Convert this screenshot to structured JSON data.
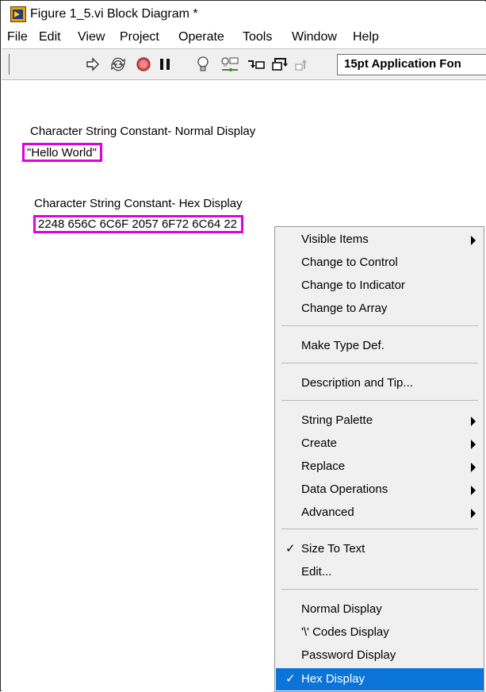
{
  "window": {
    "title": "Figure 1_5.vi Block Diagram *"
  },
  "menubar": {
    "items": [
      "File",
      "Edit",
      "View",
      "Project",
      "Operate",
      "Tools",
      "Window",
      "Help"
    ]
  },
  "toolbar": {
    "icons": [
      "run-arrow-icon",
      "run-continuously-icon",
      "abort-icon",
      "pause-icon",
      "highlight-execution-icon",
      "retain-wire-values-icon",
      "step-into-icon",
      "step-over-icon",
      "step-out-icon"
    ],
    "font_selector": "15pt Application Fon"
  },
  "diagram": {
    "normal_label": "Character String Constant- Normal Display",
    "normal_value": "\"Hello World\"",
    "hex_label": "Character String Constant- Hex Display",
    "hex_value": "2248 656C 6C6F 2057 6F72 6C64 22",
    "highlight_color": "#e200e0"
  },
  "context_menu": {
    "items": [
      {
        "label": "Visible Items",
        "submenu": true,
        "checked": false,
        "selected": false
      },
      {
        "label": "Change to Control",
        "submenu": false,
        "checked": false,
        "selected": false
      },
      {
        "label": "Change to Indicator",
        "submenu": false,
        "checked": false,
        "selected": false
      },
      {
        "label": "Change to Array",
        "submenu": false,
        "checked": false,
        "selected": false
      },
      {
        "label": "Make Type Def.",
        "submenu": false,
        "checked": false,
        "selected": false
      },
      {
        "label": "Description and Tip...",
        "submenu": false,
        "checked": false,
        "selected": false
      },
      {
        "label": "String Palette",
        "submenu": true,
        "checked": false,
        "selected": false
      },
      {
        "label": "Create",
        "submenu": true,
        "checked": false,
        "selected": false
      },
      {
        "label": "Replace",
        "submenu": true,
        "checked": false,
        "selected": false
      },
      {
        "label": "Data Operations",
        "submenu": true,
        "checked": false,
        "selected": false
      },
      {
        "label": "Advanced",
        "submenu": true,
        "checked": false,
        "selected": false
      },
      {
        "label": "Size To Text",
        "submenu": false,
        "checked": true,
        "selected": false
      },
      {
        "label": "Edit...",
        "submenu": false,
        "checked": false,
        "selected": false
      },
      {
        "label": "Normal Display",
        "submenu": false,
        "checked": false,
        "selected": false
      },
      {
        "label": "'\\' Codes Display",
        "submenu": false,
        "checked": false,
        "selected": false
      },
      {
        "label": "Password Display",
        "submenu": false,
        "checked": false,
        "selected": false
      },
      {
        "label": "Hex Display",
        "submenu": false,
        "checked": true,
        "selected": true
      }
    ],
    "check_mark": "✓",
    "selection_color": "#0b74d8"
  }
}
